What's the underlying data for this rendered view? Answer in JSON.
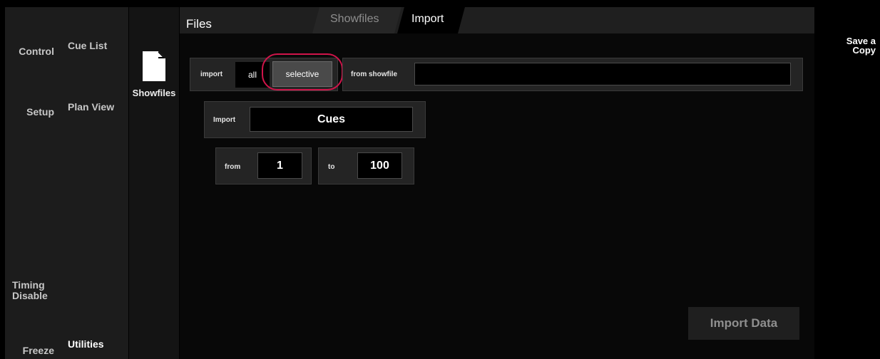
{
  "nav": {
    "control": "Control",
    "cue_list": "Cue List",
    "setup": "Setup",
    "plan_view": "Plan View",
    "timing_disable": [
      "Timing",
      "Disable"
    ],
    "freeze": "Freeze",
    "utilities": "Utilities"
  },
  "showfiles_column": {
    "label": "Showfiles",
    "icon": "document-icon"
  },
  "header": {
    "title": "Files",
    "tabs": [
      {
        "label": "Showfiles",
        "active": false
      },
      {
        "label": "Import",
        "active": true
      }
    ]
  },
  "import_row": {
    "import_label": "import",
    "option_all": "all",
    "option_selective": "selective",
    "selected_option": "selective",
    "from_showfile_label": "from showfile",
    "from_showfile_value": ""
  },
  "import_type": {
    "label": "Import",
    "value": "Cues"
  },
  "range": {
    "from_label": "from",
    "from_value": "1",
    "to_label": "to",
    "to_value": "100"
  },
  "actions": {
    "import_data": "Import Data",
    "save_copy": [
      "Save a",
      "Copy"
    ]
  },
  "colors": {
    "background": "#000000",
    "panel": "#242424",
    "highlight_ring": "#d0144a",
    "selected_segment": "#4a4a4a"
  }
}
